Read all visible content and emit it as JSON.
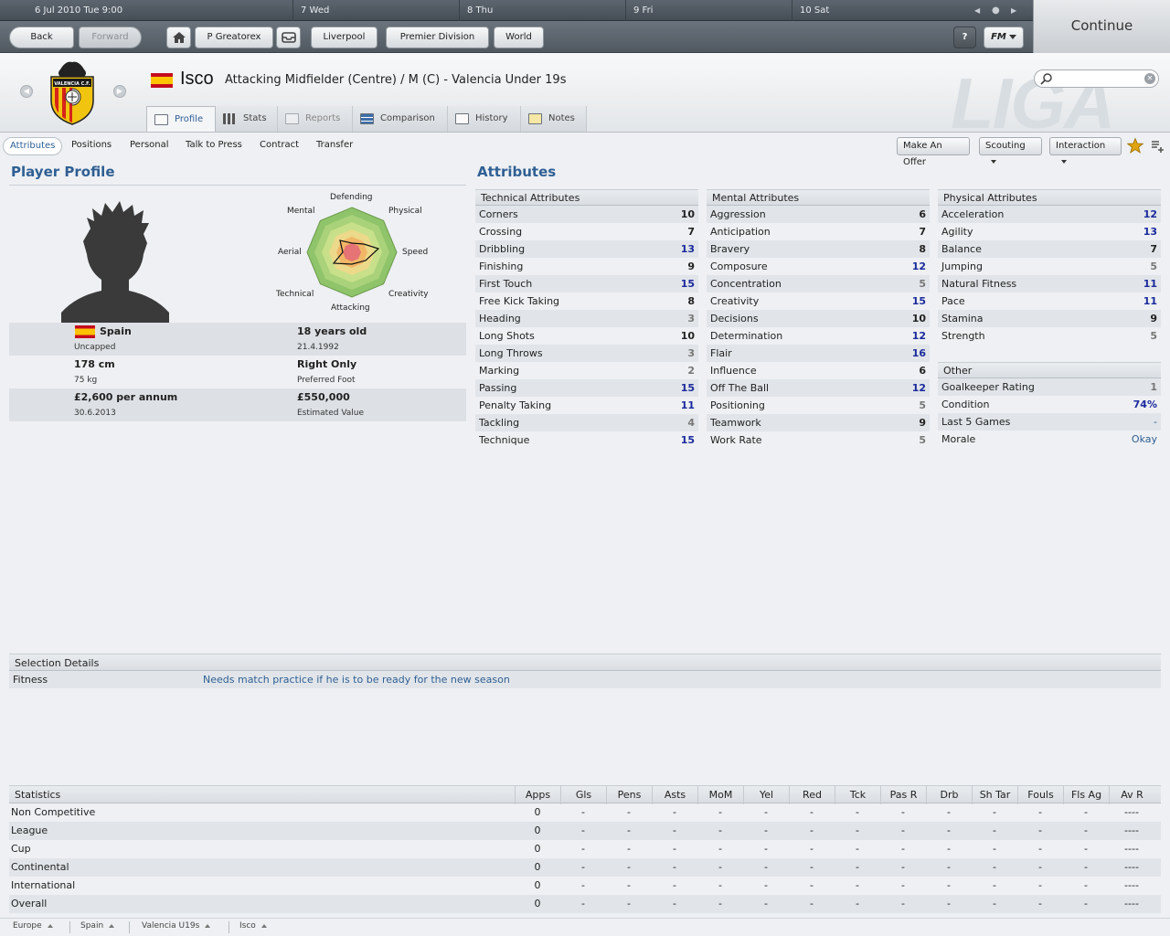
{
  "calendar": {
    "days": [
      "6 Jul 2010 Tue 9:00",
      "7 Wed",
      "8 Thu",
      "9 Fri",
      "10 Sat"
    ]
  },
  "continue_label": "Continue",
  "toolbar": {
    "back": "Back",
    "forward": "Forward",
    "manager": "P Greatorex",
    "club": "Liverpool",
    "competition": "Premier Division",
    "world": "World",
    "help": "?",
    "fm_menu": "FM"
  },
  "header": {
    "player_name": "Isco",
    "description": "Attacking Midfielder (Centre) / M (C) - Valencia Under 19s",
    "watermark": "LIGA",
    "crest_text": "VALENCIA C.F."
  },
  "tabs": [
    "Profile",
    "Stats",
    "Reports",
    "Comparison",
    "History",
    "Notes"
  ],
  "subtabs": [
    "Attributes",
    "Positions",
    "Personal",
    "Talk to Press",
    "Contract",
    "Transfer"
  ],
  "actions": {
    "make_offer": "Make An Offer",
    "scouting": "Scouting",
    "interaction": "Interaction"
  },
  "profile": {
    "title": "Player Profile",
    "radar_labels": {
      "defending": "Defending",
      "physical": "Physical",
      "speed": "Speed",
      "creativity": "Creativity",
      "attacking": "Attacking",
      "technical": "Technical",
      "aerial": "Aerial",
      "mental": "Mental"
    },
    "nationality": "Spain",
    "caps": "Uncapped",
    "age": "18 years old",
    "dob": "21.4.1992",
    "height": "178 cm",
    "weight": "75 kg",
    "foot": "Right Only",
    "foot_label": "Preferred Foot",
    "wage": "£2,600 per annum",
    "contract_end": "30.6.2013",
    "value": "£550,000",
    "value_label": "Estimated Value"
  },
  "attributes_title": "Attributes",
  "technical": {
    "title": "Technical Attributes",
    "rows": [
      {
        "name": "Corners",
        "value": "10"
      },
      {
        "name": "Crossing",
        "value": "7"
      },
      {
        "name": "Dribbling",
        "value": "13"
      },
      {
        "name": "Finishing",
        "value": "9"
      },
      {
        "name": "First Touch",
        "value": "15"
      },
      {
        "name": "Free Kick Taking",
        "value": "8"
      },
      {
        "name": "Heading",
        "value": "3"
      },
      {
        "name": "Long Shots",
        "value": "10"
      },
      {
        "name": "Long Throws",
        "value": "3"
      },
      {
        "name": "Marking",
        "value": "2"
      },
      {
        "name": "Passing",
        "value": "15"
      },
      {
        "name": "Penalty Taking",
        "value": "11"
      },
      {
        "name": "Tackling",
        "value": "4"
      },
      {
        "name": "Technique",
        "value": "15"
      }
    ]
  },
  "mental": {
    "title": "Mental Attributes",
    "rows": [
      {
        "name": "Aggression",
        "value": "6"
      },
      {
        "name": "Anticipation",
        "value": "7"
      },
      {
        "name": "Bravery",
        "value": "8"
      },
      {
        "name": "Composure",
        "value": "12"
      },
      {
        "name": "Concentration",
        "value": "5"
      },
      {
        "name": "Creativity",
        "value": "15"
      },
      {
        "name": "Decisions",
        "value": "10"
      },
      {
        "name": "Determination",
        "value": "12"
      },
      {
        "name": "Flair",
        "value": "16"
      },
      {
        "name": "Influence",
        "value": "6"
      },
      {
        "name": "Off The Ball",
        "value": "12"
      },
      {
        "name": "Positioning",
        "value": "5"
      },
      {
        "name": "Teamwork",
        "value": "9"
      },
      {
        "name": "Work Rate",
        "value": "5"
      }
    ]
  },
  "physical": {
    "title": "Physical Attributes",
    "rows": [
      {
        "name": "Acceleration",
        "value": "12"
      },
      {
        "name": "Agility",
        "value": "13"
      },
      {
        "name": "Balance",
        "value": "7"
      },
      {
        "name": "Jumping",
        "value": "5"
      },
      {
        "name": "Natural Fitness",
        "value": "11"
      },
      {
        "name": "Pace",
        "value": "11"
      },
      {
        "name": "Stamina",
        "value": "9"
      },
      {
        "name": "Strength",
        "value": "5"
      }
    ]
  },
  "other": {
    "title": "Other",
    "rows": [
      {
        "name": "Goalkeeper Rating",
        "value": "1"
      },
      {
        "name": "Condition",
        "value": "74%"
      },
      {
        "name": "Last 5 Games",
        "value": "-"
      },
      {
        "name": "Morale",
        "value": "Okay"
      }
    ]
  },
  "selection": {
    "title": "Selection Details",
    "label": "Fitness",
    "value": "Needs match practice if he is to be ready for the new season"
  },
  "stats": {
    "title": "Statistics",
    "columns": [
      "Apps",
      "Gls",
      "Pens",
      "Asts",
      "MoM",
      "Yel",
      "Red",
      "Tck",
      "Pas R",
      "Drb",
      "Sh Tar",
      "Fouls",
      "Fls Ag",
      "Av R"
    ],
    "rows": [
      {
        "name": "Non Competitive",
        "cells": [
          "0",
          "-",
          "-",
          "-",
          "-",
          "-",
          "-",
          "-",
          "-",
          "-",
          "-",
          "-",
          "-",
          "----"
        ]
      },
      {
        "name": "League",
        "cells": [
          "0",
          "-",
          "-",
          "-",
          "-",
          "-",
          "-",
          "-",
          "-",
          "-",
          "-",
          "-",
          "-",
          "----"
        ]
      },
      {
        "name": "Cup",
        "cells": [
          "0",
          "-",
          "-",
          "-",
          "-",
          "-",
          "-",
          "-",
          "-",
          "-",
          "-",
          "-",
          "-",
          "----"
        ]
      },
      {
        "name": "Continental",
        "cells": [
          "0",
          "-",
          "-",
          "-",
          "-",
          "-",
          "-",
          "-",
          "-",
          "-",
          "-",
          "-",
          "-",
          "----"
        ]
      },
      {
        "name": "International",
        "cells": [
          "0",
          "-",
          "-",
          "-",
          "-",
          "-",
          "-",
          "-",
          "-",
          "-",
          "-",
          "-",
          "-",
          "----"
        ]
      },
      {
        "name": "Overall",
        "cells": [
          "0",
          "-",
          "-",
          "-",
          "-",
          "-",
          "-",
          "-",
          "-",
          "-",
          "-",
          "-",
          "-",
          "----"
        ]
      }
    ]
  },
  "breadcrumbs": [
    "Europe",
    "Spain",
    "Valencia U19s",
    "Isco"
  ],
  "colors": {
    "accent": "#2f5f93",
    "high_value": "#1a2a9c",
    "normal_value": "#222222",
    "low_value": "#777777"
  }
}
